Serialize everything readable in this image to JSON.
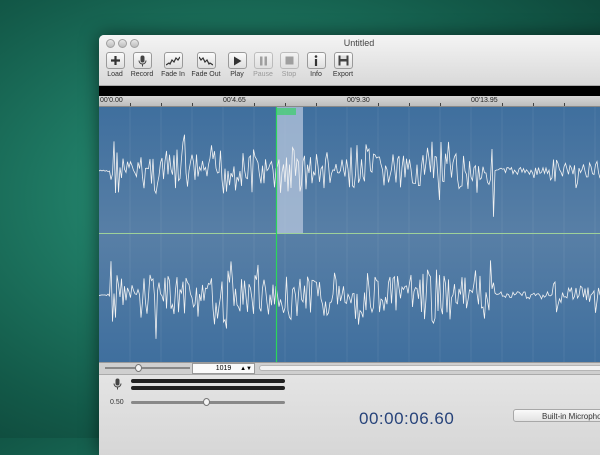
{
  "window": {
    "title": "Untitled"
  },
  "toolbar": [
    {
      "name": "load",
      "label": "Load",
      "icon": "plus-icon",
      "enabled": true
    },
    {
      "name": "record",
      "label": "Record",
      "icon": "microphone-icon",
      "enabled": true
    },
    {
      "name": "fade-in",
      "label": "Fade In",
      "icon": "fade-in-icon",
      "enabled": true
    },
    {
      "name": "fade-out",
      "label": "Fade Out",
      "icon": "fade-out-icon",
      "enabled": true
    },
    {
      "name": "play",
      "label": "Play",
      "icon": "play-icon",
      "enabled": true
    },
    {
      "name": "pause",
      "label": "Pause",
      "icon": "pause-icon",
      "enabled": false
    },
    {
      "name": "stop",
      "label": "Stop",
      "icon": "stop-icon",
      "enabled": false
    },
    {
      "name": "info",
      "label": "Info",
      "icon": "info-icon",
      "enabled": true
    },
    {
      "name": "export",
      "label": "Export",
      "icon": "floppy-disk-icon",
      "enabled": true
    }
  ],
  "ruler": {
    "labels": [
      "00'0.00",
      "00'4.65",
      "00'9.30",
      "00'13.95"
    ]
  },
  "bottom": {
    "zoom_value": "1019",
    "volume_label": "0.50",
    "timecode": "00:00:06.60",
    "input_device": "Built-in Microphone"
  },
  "colors": {
    "waveform_bg": "#4a77a3",
    "playhead": "#2bd65a",
    "selection": "#b7c7dd",
    "timecode": "#27437a"
  }
}
